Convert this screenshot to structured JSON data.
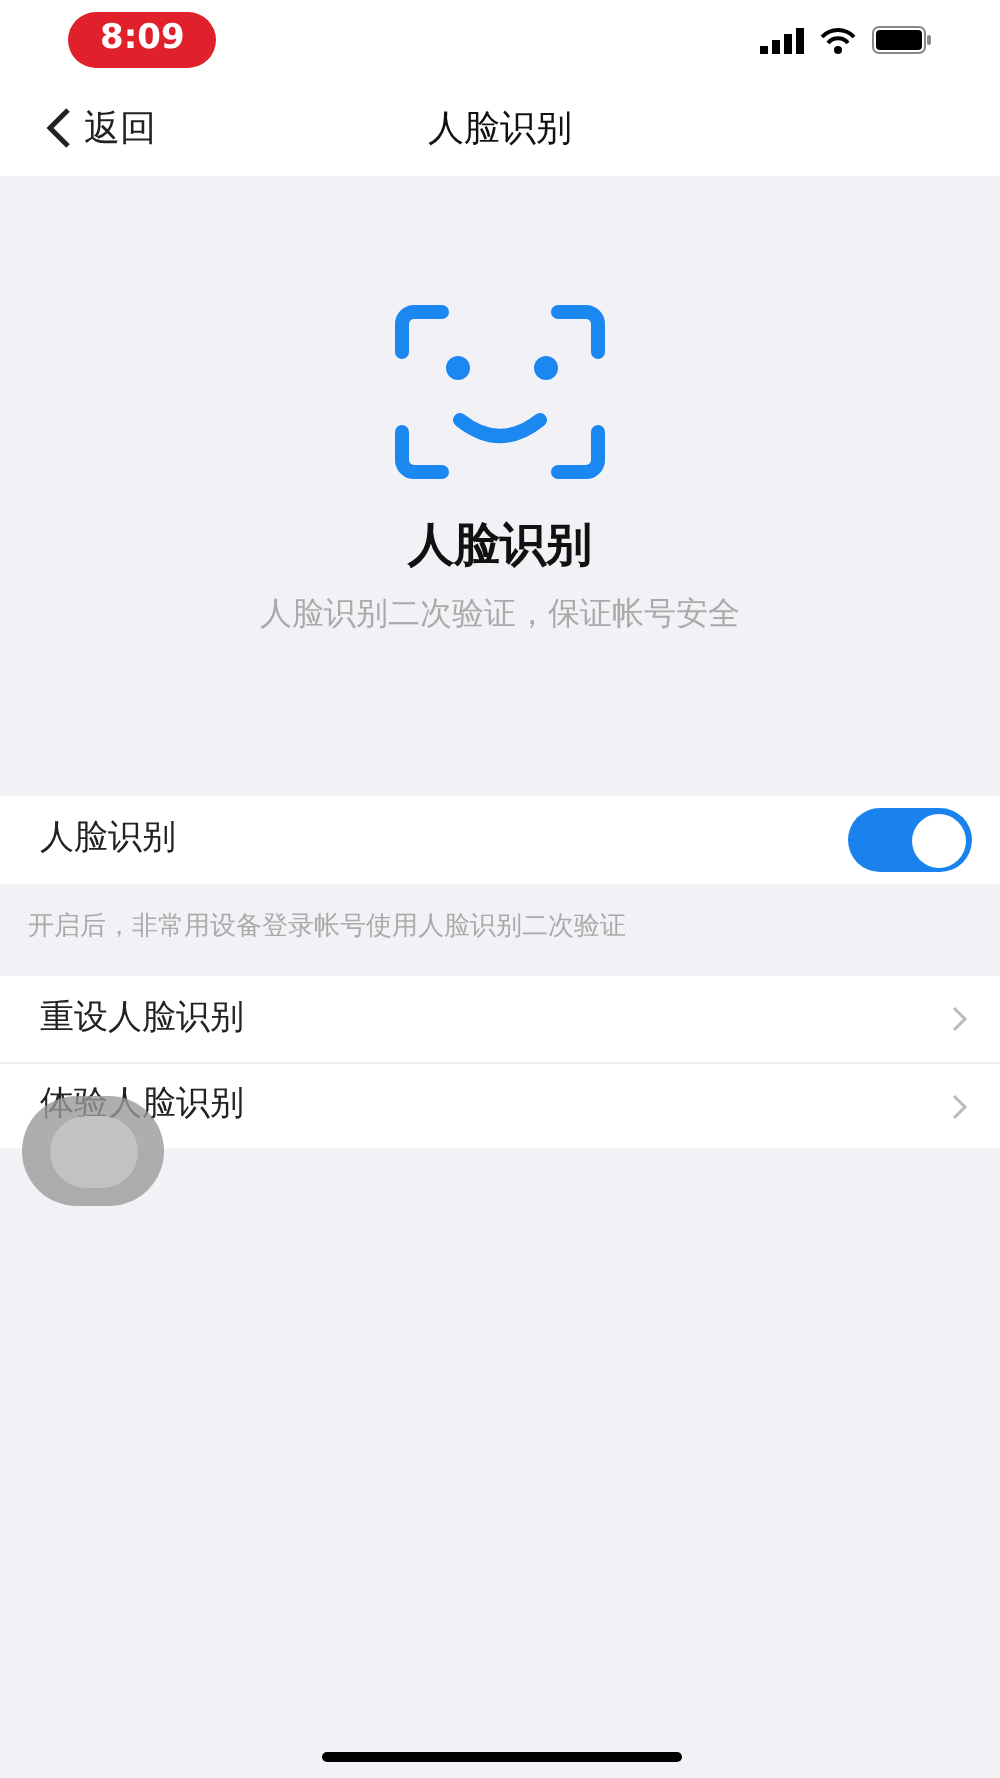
{
  "status_bar": {
    "time": "8:09"
  },
  "nav": {
    "back": "返回",
    "title": "人脸识别"
  },
  "hero": {
    "title": "人脸识别",
    "subtitle": "人脸识别二次验证，保证帐号安全"
  },
  "toggle_row": {
    "label": "人脸识别",
    "on": true
  },
  "hint": "开启后，非常用设备登录帐号使用人脸识别二次验证",
  "menu": [
    {
      "label": "重设人脸识别"
    },
    {
      "label": "体验人脸识别"
    }
  ]
}
